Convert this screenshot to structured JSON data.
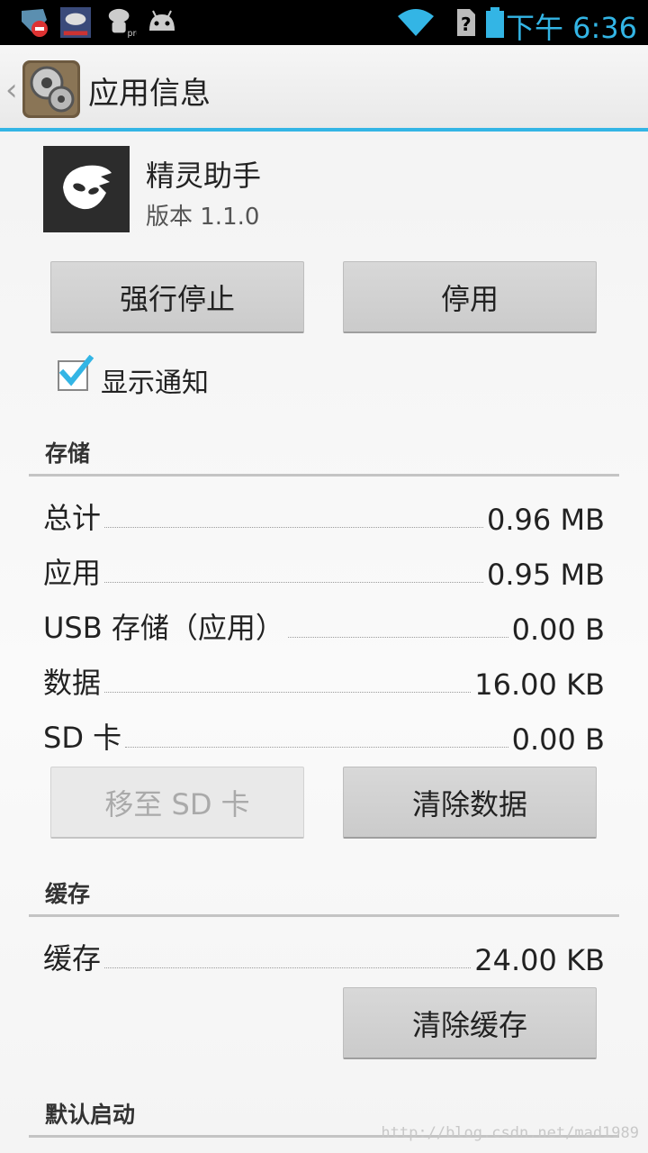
{
  "status_bar": {
    "time": "下午 6:36",
    "left_icons": [
      "app-shield-icon",
      "cloud-app-icon",
      "android-pro-icon",
      "android-icon"
    ],
    "right_icons": [
      "wifi-icon",
      "no-sim-icon",
      "battery-icon"
    ],
    "accent_color": "#33b5e5"
  },
  "action_bar": {
    "back_glyph": "‹",
    "title": "应用信息",
    "accent_color": "#33b5e5"
  },
  "app": {
    "name": "精灵助手",
    "version": "版本 1.1.0",
    "icon": "mask-icon"
  },
  "buttons": {
    "force_stop": "强行停止",
    "disable": "停用",
    "move_to_sd": "移至 SD 卡",
    "clear_data": "清除数据",
    "clear_cache": "清除缓存"
  },
  "show_notifications": {
    "label": "显示通知",
    "checked": true
  },
  "storage": {
    "header": "存储",
    "rows": [
      {
        "label": "总计",
        "value": "0.96 MB"
      },
      {
        "label": "应用",
        "value": "0.95 MB"
      },
      {
        "label": "USB 存储（应用）",
        "value": "0.00 B"
      },
      {
        "label": "数据",
        "value": "16.00 KB"
      },
      {
        "label": "SD 卡",
        "value": "0.00 B"
      }
    ]
  },
  "cache": {
    "header": "缓存",
    "rows": [
      {
        "label": "缓存",
        "value": "24.00 KB"
      }
    ]
  },
  "default_launch": {
    "header": "默认启动"
  },
  "watermark": "http://blog.csdn.net/mad1989"
}
